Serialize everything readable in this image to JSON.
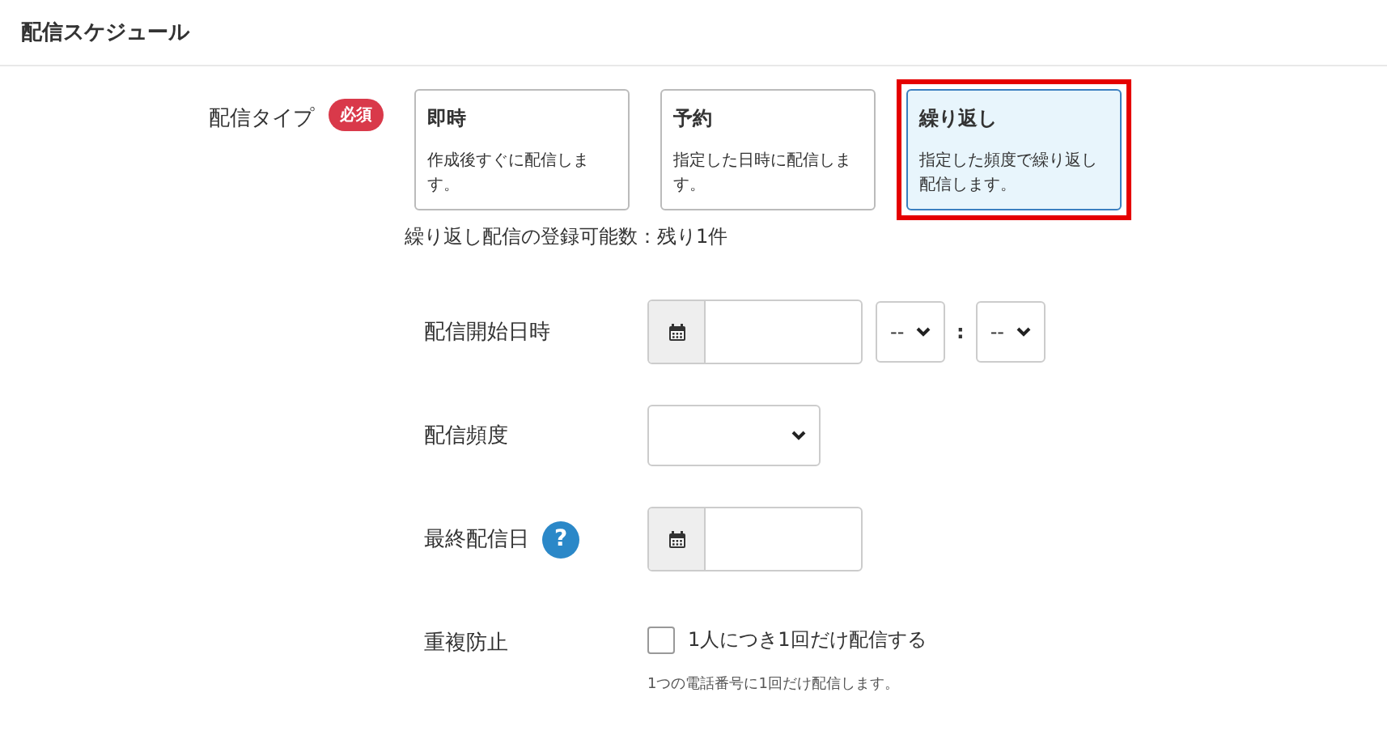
{
  "section_title": "配信スケジュール",
  "delivery_type": {
    "label": "配信タイプ",
    "badge": "必須",
    "options": [
      {
        "title": "即時",
        "description": "作成後すぐに配信します。",
        "selected": false
      },
      {
        "title": "予約",
        "description": "指定した日時に配信します。",
        "selected": false
      },
      {
        "title": "繰り返し",
        "description": "指定した頻度で繰り返し配信します。",
        "selected": true
      }
    ],
    "note": "繰り返し配信の登録可能数：残り1件"
  },
  "fields": [
    {
      "kind": "datetime",
      "label": "配信開始日時",
      "hour": "--",
      "separator": ":",
      "minute": "--"
    },
    {
      "kind": "select",
      "label": "配信頻度"
    },
    {
      "kind": "date",
      "label": "最終配信日",
      "help": "?"
    },
    {
      "kind": "checkbox",
      "label": "重複防止",
      "option": "1人につき1回だけ配信する",
      "checked": false,
      "hint": "1つの電話番号に1回だけ配信します。"
    }
  ]
}
